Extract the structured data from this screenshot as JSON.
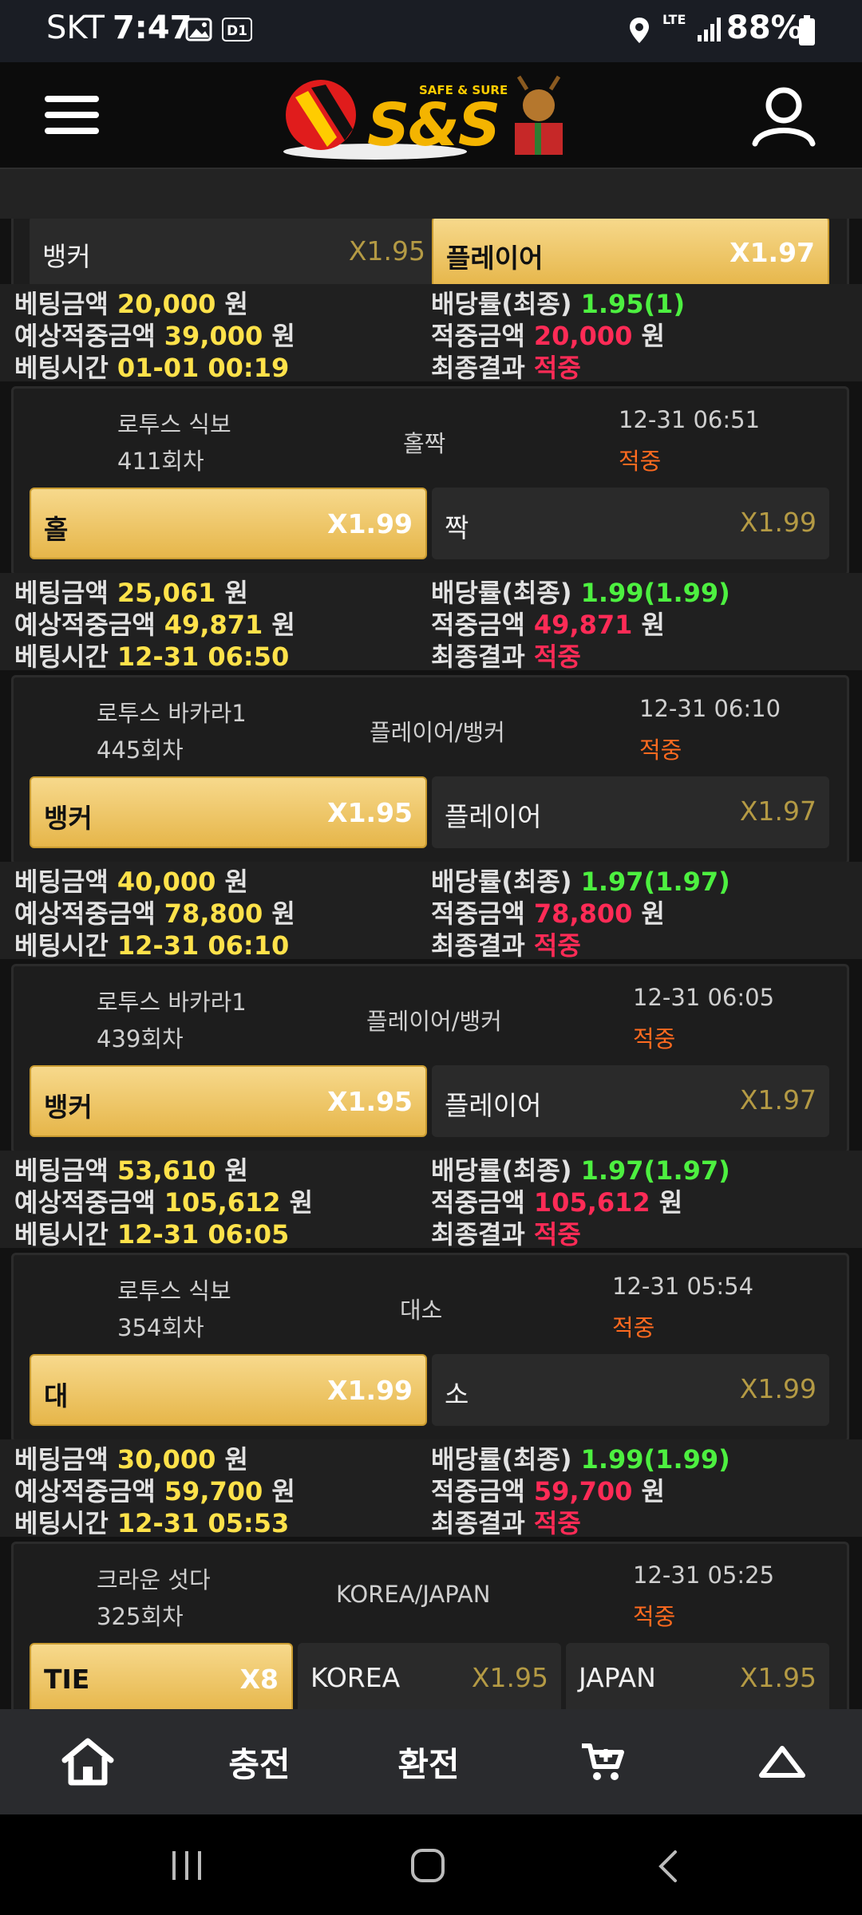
{
  "status_bar": {
    "carrier": "SKT",
    "time": "7:47",
    "badge": "D1",
    "network": "LTE",
    "battery": "88%"
  },
  "header": {
    "logo_text": "S&S",
    "logo_tagline": "SAFE & SURE"
  },
  "top_card": {
    "options": [
      {
        "name": "뱅커",
        "odd": "X1.95",
        "selected": false
      },
      {
        "name": "플레이어",
        "odd": "X1.97",
        "selected": true
      }
    ]
  },
  "cards": [
    {
      "game": "로투스 식보",
      "round": "411회차",
      "market": "홀짝",
      "date": "12-31 06:51",
      "result": "적중",
      "options": [
        {
          "name": "홀",
          "odd": "X1.99",
          "selected": true
        },
        {
          "name": "짝",
          "odd": "X1.99",
          "selected": false
        }
      ]
    },
    {
      "game": "로투스 바카라1",
      "round": "445회차",
      "market": "플레이어/뱅커",
      "date": "12-31 06:10",
      "result": "적중",
      "options": [
        {
          "name": "뱅커",
          "odd": "X1.95",
          "selected": true
        },
        {
          "name": "플레이어",
          "odd": "X1.97",
          "selected": false
        }
      ]
    },
    {
      "game": "로투스 바카라1",
      "round": "439회차",
      "market": "플레이어/뱅커",
      "date": "12-31 06:05",
      "result": "적중",
      "options": [
        {
          "name": "뱅커",
          "odd": "X1.95",
          "selected": true
        },
        {
          "name": "플레이어",
          "odd": "X1.97",
          "selected": false
        }
      ]
    },
    {
      "game": "로투스 식보",
      "round": "354회차",
      "market": "대소",
      "date": "12-31 05:54",
      "result": "적중",
      "options": [
        {
          "name": "대",
          "odd": "X1.99",
          "selected": true
        },
        {
          "name": "소",
          "odd": "X1.99",
          "selected": false
        }
      ]
    },
    {
      "game": "크라운 섯다",
      "round": "325회차",
      "market": "KOREA/JAPAN",
      "date": "12-31 05:25",
      "result": "적중",
      "options": [
        {
          "name": "TIE",
          "odd": "X8",
          "selected": true
        },
        {
          "name": "KOREA",
          "odd": "X1.95",
          "selected": false
        },
        {
          "name": "JAPAN",
          "odd": "X1.95",
          "selected": false
        }
      ]
    }
  ],
  "labels": {
    "bet_amount": "베팅금액",
    "expected_win": "예상적중금액",
    "bet_time": "베팅시간",
    "odds_final": "배당률(최종)",
    "win_amount": "적중금액",
    "final_result": "최종결과",
    "won_unit": "원"
  },
  "summaries": [
    {
      "bet_amount": "20,000",
      "expected_win": "39,000",
      "bet_time": "01-01 00:19",
      "odds": "1.95(1)",
      "win_amount": "20,000",
      "final_result": "적중"
    },
    {
      "bet_amount": "25,061",
      "expected_win": "49,871",
      "bet_time": "12-31 06:50",
      "odds": "1.99(1.99)",
      "win_amount": "49,871",
      "final_result": "적중"
    },
    {
      "bet_amount": "40,000",
      "expected_win": "78,800",
      "bet_time": "12-31 06:10",
      "odds": "1.97(1.97)",
      "win_amount": "78,800",
      "final_result": "적중"
    },
    {
      "bet_amount": "53,610",
      "expected_win": "105,612",
      "bet_time": "12-31 06:05",
      "odds": "1.97(1.97)",
      "win_amount": "105,612",
      "final_result": "적중"
    },
    {
      "bet_amount": "30,000",
      "expected_win": "59,700",
      "bet_time": "12-31 05:53",
      "odds": "1.99(1.99)",
      "win_amount": "59,700",
      "final_result": "적중"
    }
  ],
  "bottom_nav": {
    "home_icon": "home-icon",
    "charge": "충전",
    "exchange": "환전",
    "cart_icon": "cart-icon",
    "top_icon": "scroll-top-icon"
  },
  "colors": {
    "selected_option": "#e6b64a",
    "highlight_yellow": "#ffe24a",
    "odds_green": "#4df040",
    "win_red": "#ff2b56",
    "result_orange": "#ff6a1f"
  }
}
